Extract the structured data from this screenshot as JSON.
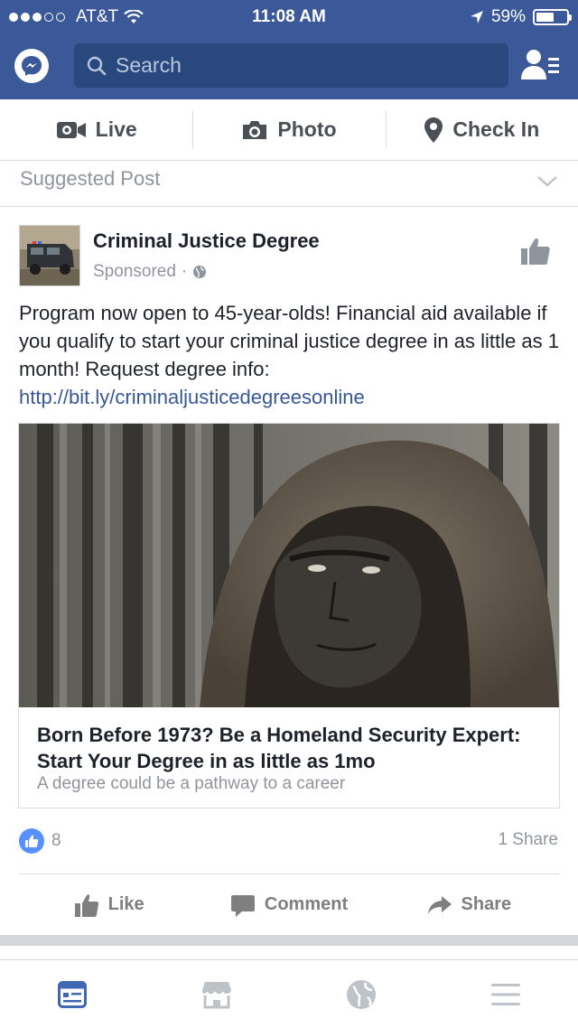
{
  "status_bar": {
    "carrier": "AT&T",
    "time": "11:08 AM",
    "battery_text": "59%",
    "battery_level": 0.59
  },
  "header": {
    "search_placeholder": "Search"
  },
  "composer": {
    "live": "Live",
    "photo": "Photo",
    "check_in": "Check In"
  },
  "feed": {
    "suggested_label": "Suggested Post",
    "post": {
      "page_name": "Criminal Justice Degree",
      "sponsored": "Sponsored",
      "text": "Program now open to 45-year-olds! Financial aid available if you qualify to start your criminal justice degree in as little as 1 month! Request degree info:",
      "link": "http://bit.ly/criminaljusticedegreesonline",
      "card": {
        "headline": "Born Before 1973? Be a Homeland Security Expert: Start Your Degree in as little as 1mo",
        "description": "A degree could be a pathway to a career"
      },
      "like_count": "8",
      "share_count": "1 Share",
      "actions": {
        "like": "Like",
        "comment": "Comment",
        "share": "Share"
      }
    }
  },
  "colors": {
    "brand_blue": "#3b5998",
    "search_bg": "#29487d",
    "link_blue": "#365899",
    "like_blue": "#5890ff",
    "muted_text": "#90949c"
  },
  "icons": {
    "tabs": [
      "news-feed-icon",
      "marketplace-icon",
      "globe-icon",
      "menu-icon"
    ]
  }
}
